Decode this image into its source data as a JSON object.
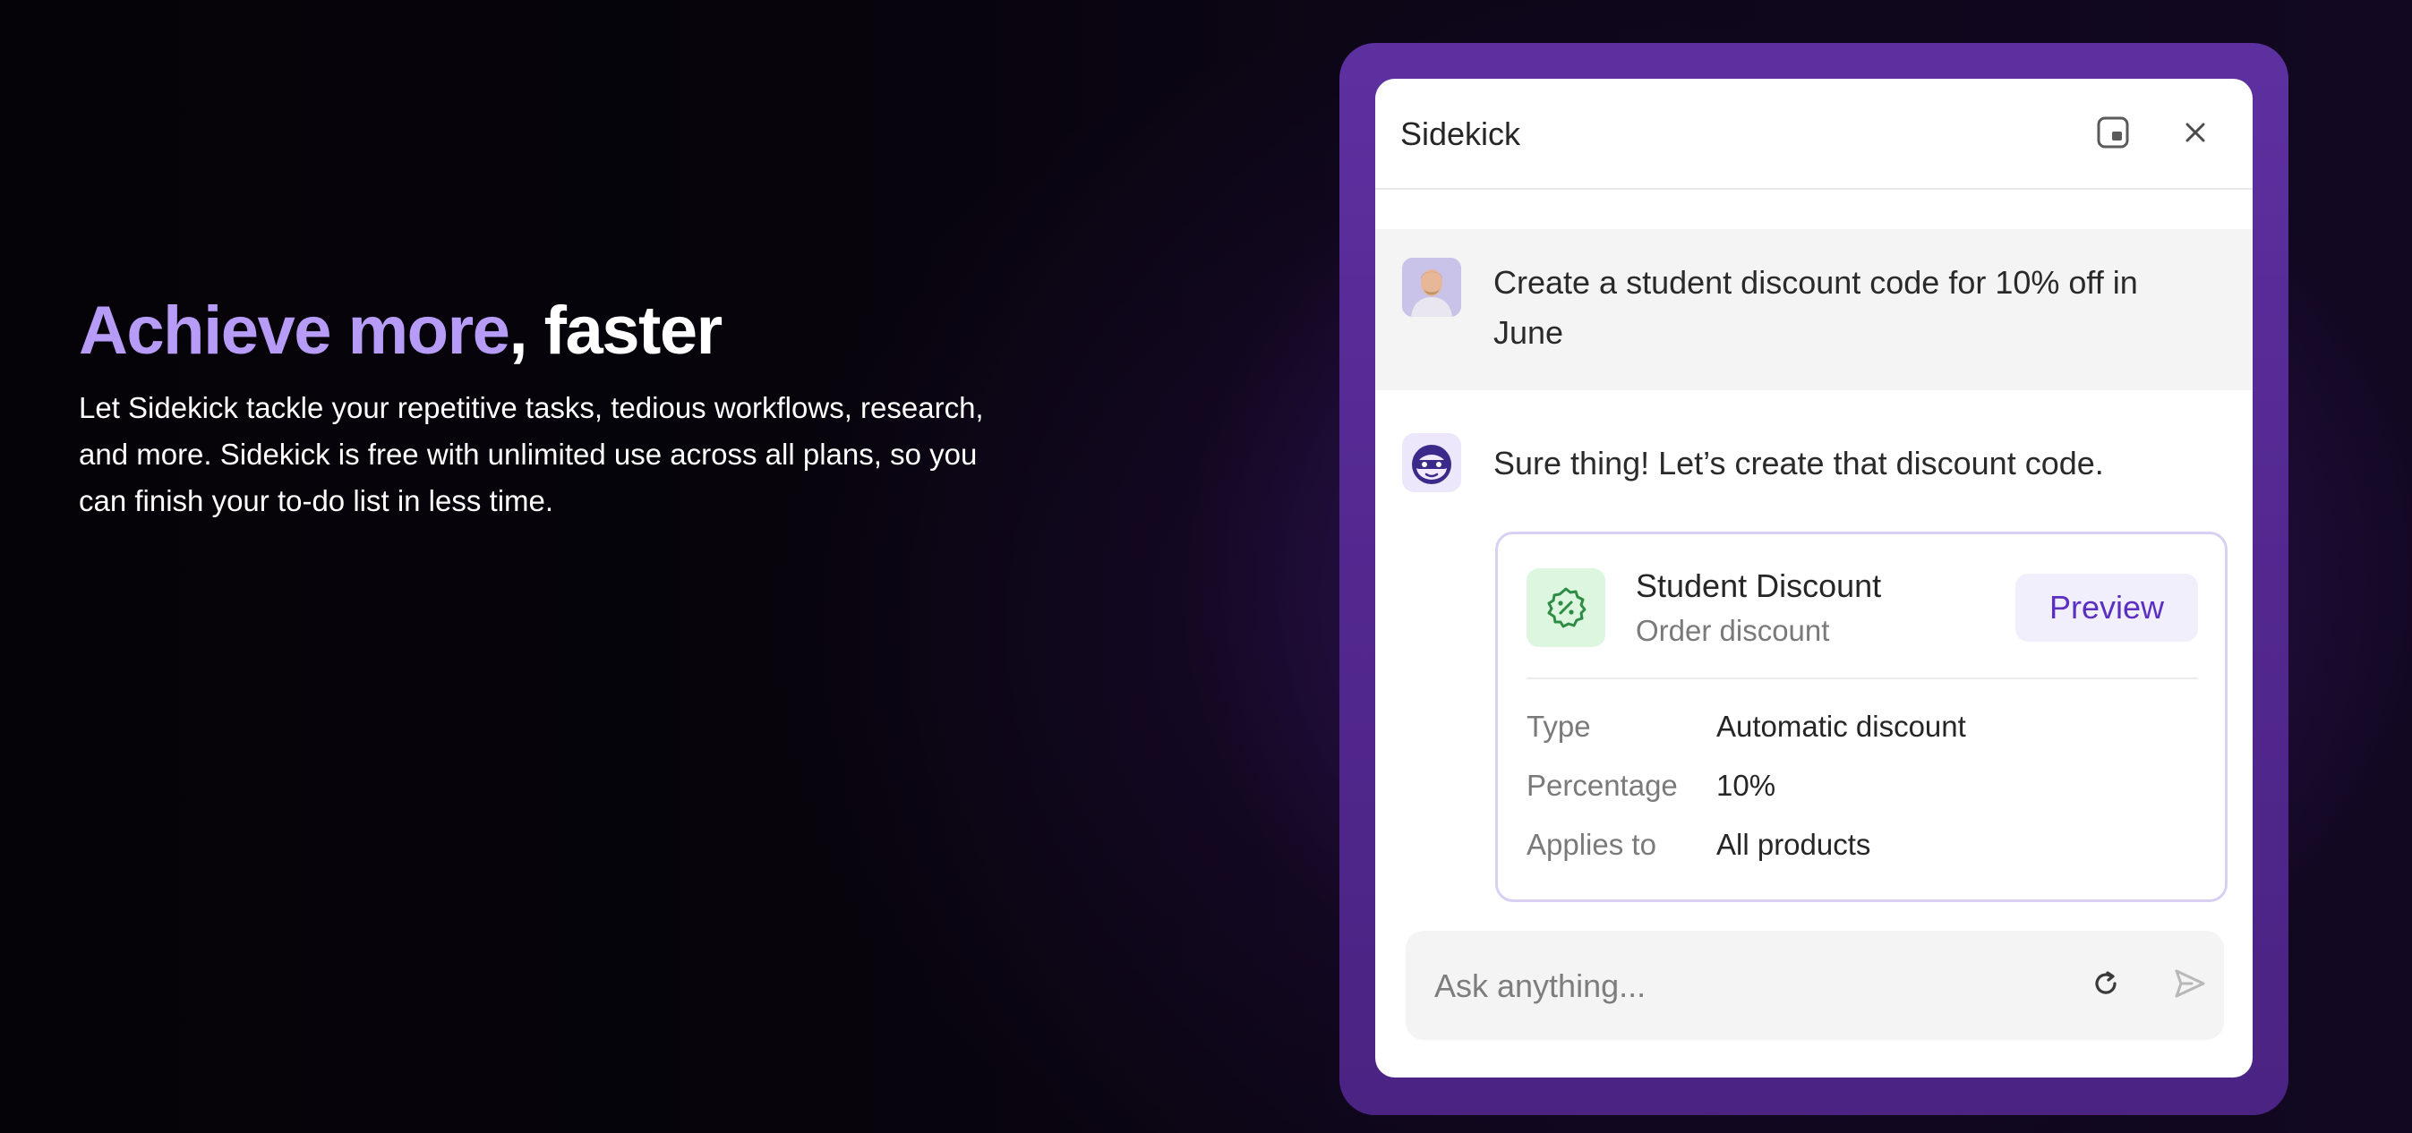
{
  "hero": {
    "title_accent": "Achieve more",
    "title_rest": ", faster",
    "body": "Let Sidekick tackle your repetitive tasks, tedious workflows, research, and more. Sidekick is free with unlimited use across all plans, so you can finish your to-do list in less time."
  },
  "panel": {
    "title": "Sidekick",
    "dock_icon": "dock-window-icon",
    "close_icon": "close-icon"
  },
  "conversation": {
    "user_message": "Create a student discount code for 10% off in June",
    "bot_message": "Sure thing! Let’s create that discount code."
  },
  "discount_card": {
    "icon": "discount-badge-icon",
    "name": "Student Discount",
    "subtitle": "Order discount",
    "preview_label": "Preview",
    "details": [
      {
        "label": "Type",
        "value": "Automatic discount"
      },
      {
        "label": "Percentage",
        "value": "10%"
      },
      {
        "label": "Applies to",
        "value": "All products"
      }
    ]
  },
  "composer": {
    "placeholder": "Ask anything...",
    "value": "",
    "refresh_icon": "refresh-icon",
    "send_icon": "send-icon"
  },
  "colors": {
    "accent_text": "#b79cf7",
    "frame_purple": "#5d30a0",
    "preview_text": "#5b2fc2",
    "discount_icon_green": "#2e8c45"
  }
}
